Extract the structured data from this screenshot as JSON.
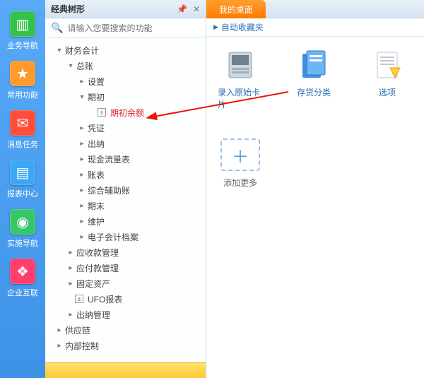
{
  "iconbar": [
    {
      "name": "biz-nav",
      "label": "业务导航",
      "bg": "#34c24a",
      "glyph": "▥"
    },
    {
      "name": "common",
      "label": "常用功能",
      "bg": "#ff9a2e",
      "glyph": "★"
    },
    {
      "name": "msg-tasks",
      "label": "消息任务",
      "bg": "#ff4d3a",
      "glyph": "✉"
    },
    {
      "name": "report",
      "label": "报表中心",
      "bg": "#3ea7f5",
      "glyph": "▤"
    },
    {
      "name": "impl",
      "label": "实施导航",
      "bg": "#37c76a",
      "glyph": "◉"
    },
    {
      "name": "ent",
      "label": "企业互联",
      "bg": "#ff3e6c",
      "glyph": "❖"
    }
  ],
  "panel": {
    "title": "经典树形",
    "pin": "📌",
    "close": "✕",
    "search_placeholder": "请输入您要搜索的功能"
  },
  "tree": [
    {
      "lvl": 0,
      "tw": "▾",
      "name": "financial",
      "label": "财务会计"
    },
    {
      "lvl": 1,
      "tw": "▾",
      "name": "gl",
      "label": "总账"
    },
    {
      "lvl": 2,
      "tw": "▸",
      "name": "settings",
      "label": "设置"
    },
    {
      "lvl": 2,
      "tw": "▾",
      "name": "opening",
      "label": "期初"
    },
    {
      "lvl": 3,
      "tw": "",
      "name": "opening-balance",
      "label": "期初余额",
      "leaf": true,
      "hl": true
    },
    {
      "lvl": 2,
      "tw": "▸",
      "name": "voucher",
      "label": "凭证"
    },
    {
      "lvl": 2,
      "tw": "▸",
      "name": "cashier",
      "label": "出纳"
    },
    {
      "lvl": 2,
      "tw": "▸",
      "name": "cashflow",
      "label": "现金流量表"
    },
    {
      "lvl": 2,
      "tw": "▸",
      "name": "books",
      "label": "账表"
    },
    {
      "lvl": 2,
      "tw": "▸",
      "name": "aux",
      "label": "综合辅助账"
    },
    {
      "lvl": 2,
      "tw": "▸",
      "name": "period-end",
      "label": "期末"
    },
    {
      "lvl": 2,
      "tw": "▸",
      "name": "maintain",
      "label": "维护"
    },
    {
      "lvl": 2,
      "tw": "▸",
      "name": "earchive",
      "label": "电子会计档案"
    },
    {
      "lvl": 1,
      "tw": "▸",
      "name": "ar",
      "label": "应收款管理"
    },
    {
      "lvl": 1,
      "tw": "▸",
      "name": "ap",
      "label": "应付款管理"
    },
    {
      "lvl": 1,
      "tw": "▸",
      "name": "fa",
      "label": "固定资产"
    },
    {
      "lvl": 1,
      "tw": "",
      "name": "ufo",
      "label": "UFO报表",
      "leaf": true
    },
    {
      "lvl": 1,
      "tw": "▸",
      "name": "cash-mgt",
      "label": "出纳管理"
    },
    {
      "lvl": 0,
      "tw": "▸",
      "name": "scm",
      "label": "供应链"
    },
    {
      "lvl": 0,
      "tw": "▸",
      "name": "ic",
      "label": "内部控制"
    }
  ],
  "content": {
    "tab": "我的桌面",
    "fav": "自动收藏夹",
    "items": [
      {
        "name": "enter-card",
        "label": "录入原始卡片"
      },
      {
        "name": "stock-cat",
        "label": "存货分类"
      },
      {
        "name": "options",
        "label": "选项"
      }
    ],
    "add": "添加更多"
  }
}
